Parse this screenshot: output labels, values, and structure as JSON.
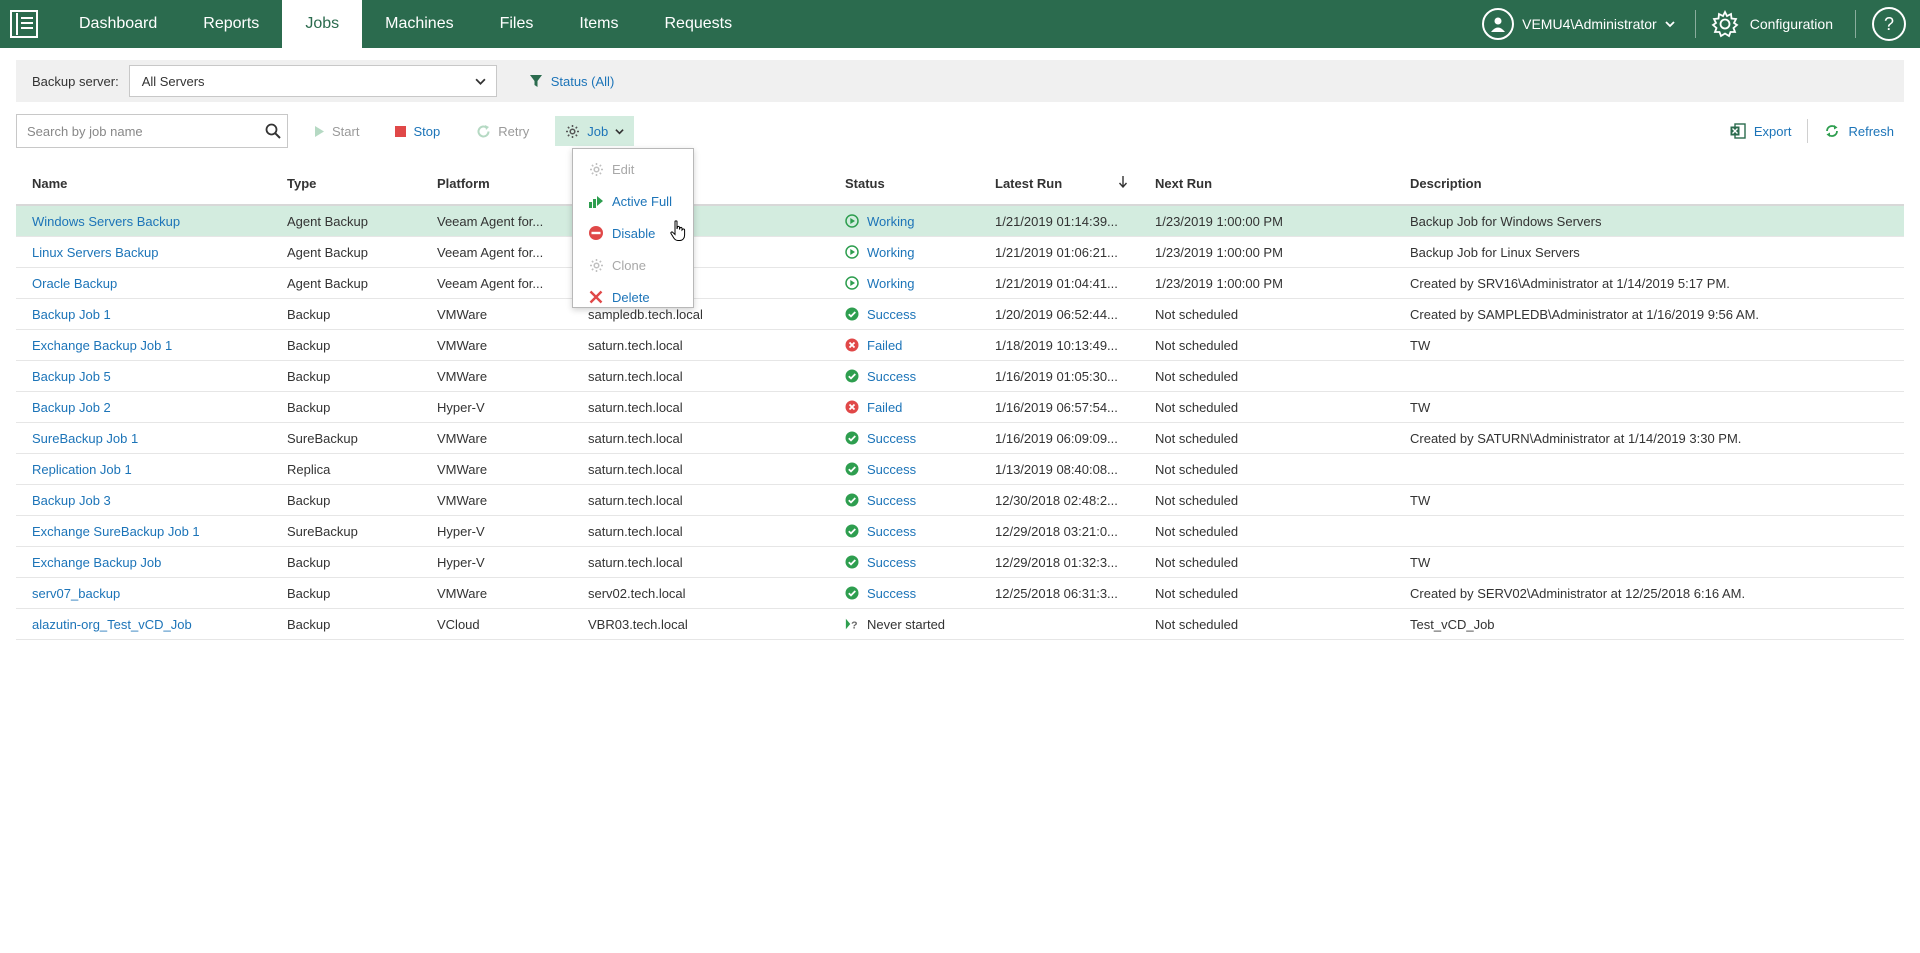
{
  "nav": {
    "items": [
      {
        "label": "Dashboard",
        "active": false
      },
      {
        "label": "Reports",
        "active": false
      },
      {
        "label": "Jobs",
        "active": true
      },
      {
        "label": "Machines",
        "active": false
      },
      {
        "label": "Files",
        "active": false
      },
      {
        "label": "Items",
        "active": false
      },
      {
        "label": "Requests",
        "active": false
      }
    ],
    "user": "VEMU4\\Administrator",
    "configuration": "Configuration",
    "help": "?"
  },
  "filter": {
    "backup_server_label": "Backup server:",
    "backup_server_value": "All Servers",
    "status_filter": "Status (All)"
  },
  "toolbar": {
    "search_placeholder": "Search by job name",
    "start": "Start",
    "stop": "Stop",
    "retry": "Retry",
    "job": "Job",
    "export": "Export",
    "refresh": "Refresh"
  },
  "job_menu": {
    "items": [
      {
        "label": "Edit",
        "enabled": false,
        "icon": "gear-icon"
      },
      {
        "label": "Active Full",
        "enabled": true,
        "icon": "active-full-icon"
      },
      {
        "label": "Disable",
        "enabled": true,
        "icon": "disable-icon"
      },
      {
        "label": "Clone",
        "enabled": false,
        "icon": "clone-icon"
      },
      {
        "label": "Delete",
        "enabled": true,
        "icon": "delete-icon"
      }
    ]
  },
  "table": {
    "columns": [
      "Name",
      "Type",
      "Platform",
      "",
      "Status",
      "Latest Run",
      "Next Run",
      "Description"
    ],
    "rows": [
      {
        "name": "Windows Servers Backup",
        "type": "Agent Backup",
        "platform": "Veeam Agent for...",
        "host": "",
        "status": "Working",
        "latest": "1/21/2019 01:14:39...",
        "next": "1/23/2019 1:00:00 PM",
        "desc": "Backup Job for Windows Servers",
        "selected": true
      },
      {
        "name": "Linux Servers Backup",
        "type": "Agent Backup",
        "platform": "Veeam Agent for...",
        "host": "",
        "status": "Working",
        "latest": "1/21/2019 01:06:21...",
        "next": "1/23/2019 1:00:00 PM",
        "desc": "Backup Job for Linux Servers"
      },
      {
        "name": "Oracle Backup",
        "type": "Agent Backup",
        "platform": "Veeam Agent for...",
        "host": "",
        "status": "Working",
        "latest": "1/21/2019 01:04:41...",
        "next": "1/23/2019 1:00:00 PM",
        "desc": "Created by SRV16\\Administrator at 1/14/2019 5:17 PM."
      },
      {
        "name": "Backup Job 1",
        "type": "Backup",
        "platform": "VMWare",
        "host": "sampledb.tech.local",
        "status": "Success",
        "latest": "1/20/2019 06:52:44...",
        "next": "Not scheduled",
        "desc": "Created by SAMPLEDB\\Administrator at 1/16/2019 9:56 AM."
      },
      {
        "name": "Exchange Backup Job 1",
        "type": "Backup",
        "platform": "VMWare",
        "host": "saturn.tech.local",
        "status": "Failed",
        "latest": "1/18/2019 10:13:49...",
        "next": "Not scheduled",
        "desc": "TW"
      },
      {
        "name": "Backup Job 5",
        "type": "Backup",
        "platform": "VMWare",
        "host": "saturn.tech.local",
        "status": "Success",
        "latest": "1/16/2019 01:05:30...",
        "next": "Not scheduled",
        "desc": ""
      },
      {
        "name": "Backup Job 2",
        "type": "Backup",
        "platform": "Hyper-V",
        "host": "saturn.tech.local",
        "status": "Failed",
        "latest": "1/16/2019 06:57:54...",
        "next": "Not scheduled",
        "desc": "TW"
      },
      {
        "name": "SureBackup Job 1",
        "type": "SureBackup",
        "platform": "VMWare",
        "host": "saturn.tech.local",
        "status": "Success",
        "latest": "1/16/2019 06:09:09...",
        "next": "Not scheduled",
        "desc": "Created by SATURN\\Administrator at 1/14/2019 3:30 PM."
      },
      {
        "name": "Replication Job 1",
        "type": "Replica",
        "platform": "VMWare",
        "host": "saturn.tech.local",
        "status": "Success",
        "latest": "1/13/2019 08:40:08...",
        "next": "Not scheduled",
        "desc": ""
      },
      {
        "name": "Backup Job 3",
        "type": "Backup",
        "platform": "VMWare",
        "host": "saturn.tech.local",
        "status": "Success",
        "latest": "12/30/2018 02:48:2...",
        "next": "Not scheduled",
        "desc": "TW"
      },
      {
        "name": "Exchange SureBackup Job 1",
        "type": "SureBackup",
        "platform": "Hyper-V",
        "host": "saturn.tech.local",
        "status": "Success",
        "latest": "12/29/2018 03:21:0...",
        "next": "Not scheduled",
        "desc": ""
      },
      {
        "name": "Exchange Backup Job",
        "type": "Backup",
        "platform": "Hyper-V",
        "host": "saturn.tech.local",
        "status": "Success",
        "latest": "12/29/2018 01:32:3...",
        "next": "Not scheduled",
        "desc": "TW"
      },
      {
        "name": "serv07_backup",
        "type": "Backup",
        "platform": "VMWare",
        "host": "serv02.tech.local",
        "status": "Success",
        "latest": "12/25/2018 06:31:3...",
        "next": "Not scheduled",
        "desc": "Created by SERV02\\Administrator at 12/25/2018 6:16 AM."
      },
      {
        "name": "alazutin-org_Test_vCD_Job",
        "type": "Backup",
        "platform": "VCloud",
        "host": "VBR03.tech.local",
        "status": "Never started",
        "latest": "",
        "next": "Not scheduled",
        "desc": "Test_vCD_Job"
      }
    ]
  },
  "colors": {
    "brand": "#2b6b4e",
    "link": "#1c74b8",
    "selected_row": "#d3ecdf",
    "success": "#2e9e4f",
    "failed": "#e04848"
  }
}
